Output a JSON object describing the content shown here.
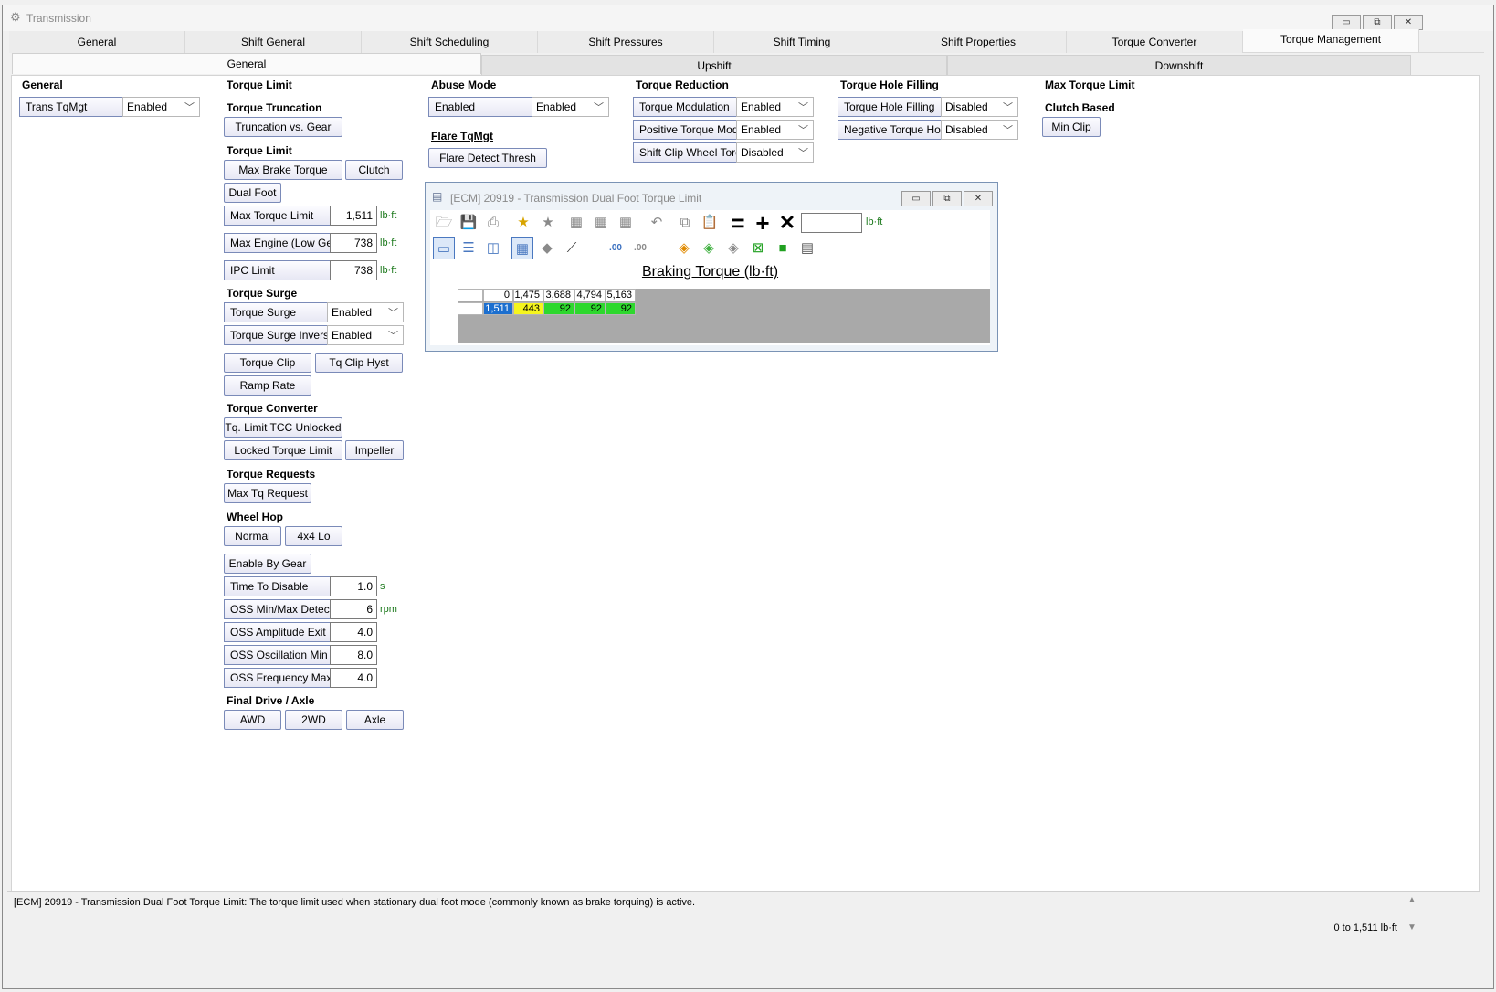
{
  "window": {
    "title": "Transmission",
    "minimize": "▭",
    "restore": "⧉",
    "close": "✕"
  },
  "top_tabs": [
    "General",
    "Shift General",
    "Shift Scheduling",
    "Shift Pressures",
    "Shift Timing",
    "Shift Properties",
    "Torque Converter",
    "Torque Management"
  ],
  "sub_tabs": [
    "General",
    "Upshift",
    "Downshift"
  ],
  "general": {
    "header": "General",
    "trans_tqmgt_label": "Trans TqMgt",
    "trans_tqmgt_value": "Enabled"
  },
  "torque_limit": {
    "header": "Torque Limit",
    "truncation_header": "Torque Truncation",
    "truncation_button": "Truncation vs. Gear",
    "limit_header": "Torque Limit",
    "max_brake_torque": "Max Brake Torque",
    "clutch": "Clutch",
    "dual_foot": "Dual Foot",
    "max_torque_limit_label": "Max Torque Limit",
    "max_torque_limit_value": "1,511",
    "max_torque_limit_unit": "lb·ft",
    "max_engine_label": "Max Engine (Low Gea",
    "max_engine_value": "738",
    "max_engine_unit": "lb·ft",
    "ipc_label": "IPC Limit",
    "ipc_value": "738",
    "ipc_unit": "lb·ft",
    "surge_header": "Torque Surge",
    "surge_label": "Torque Surge",
    "surge_value": "Enabled",
    "surge_inverse_label": "Torque Surge Inverse",
    "surge_inverse_value": "Enabled",
    "torque_clip": "Torque Clip",
    "tq_clip_hyst": "Tq Clip Hyst",
    "ramp_rate": "Ramp Rate",
    "converter_header": "Torque Converter",
    "tcc_unlocked": "Tq. Limit TCC Unlocked",
    "locked_limit": "Locked Torque Limit",
    "impeller": "Impeller",
    "requests_header": "Torque Requests",
    "max_tq_request": "Max Tq Request",
    "wheel_hop_header": "Wheel Hop",
    "normal": "Normal",
    "fourx4_lo": "4x4 Lo",
    "enable_by_gear": "Enable By Gear",
    "time_to_disable_label": "Time To Disable",
    "time_to_disable_value": "1.0",
    "time_to_disable_unit": "s",
    "oss_minmax_label": "OSS Min/Max Detecti",
    "oss_minmax_value": "6",
    "oss_minmax_unit": "rpm",
    "oss_amp_label": "OSS Amplitude Exit",
    "oss_amp_value": "4.0",
    "oss_osc_label": "OSS Oscillation Min",
    "oss_osc_value": "8.0",
    "oss_freq_label": "OSS Frequency Max",
    "oss_freq_value": "4.0",
    "final_drive_header": "Final Drive / Axle",
    "awd": "AWD",
    "twowd": "2WD",
    "axle": "Axle"
  },
  "abuse_mode": {
    "header": "Abuse Mode",
    "label": "Enabled",
    "value": "Enabled",
    "flare_header": "Flare TqMgt",
    "flare_button": "Flare Detect Thresh"
  },
  "torque_reduction": {
    "header": "Torque Reduction",
    "modulation_label": "Torque Modulation",
    "modulation_value": "Enabled",
    "positive_label": "Positive Torque Mod",
    "positive_value": "Enabled",
    "shift_clip_label": "Shift Clip Wheel Torqu",
    "shift_clip_value": "Disabled"
  },
  "torque_hole": {
    "header": "Torque Hole Filling",
    "filling_label": "Torque Hole Filling",
    "filling_value": "Disabled",
    "negative_label": "Negative Torque Hole",
    "negative_value": "Disabled"
  },
  "max_torque_limit": {
    "header": "Max Torque Limit",
    "clutch_based": "Clutch Based",
    "min_clip": "Min Clip"
  },
  "subwindow": {
    "title": "[ECM] 20919 - Transmission Dual Foot Torque Limit",
    "unit": "lb·ft",
    "table_title": "Braking Torque (lb·ft)",
    "col_headers": [
      "0",
      "1,475",
      "3,688",
      "4,794",
      "5,163"
    ],
    "row_header": "1,511",
    "row_values": [
      "443",
      "92",
      "92",
      "92"
    ],
    "colors": {
      "row_header": "#1c6fcf",
      "yellow": "#f5f51e",
      "green": "#2ed82e"
    },
    "icons_row1": [
      "folder-open-icon",
      "save-icon",
      "print-icon",
      "star-add-icon",
      "star-icon",
      "grid-icon",
      "grid-icon",
      "grid-icon",
      "undo-icon",
      "copy-icon",
      "paste-icon",
      "equals-icon",
      "plus-icon",
      "multiply-icon"
    ],
    "icons_row2": [
      "view-icon",
      "split-h-icon",
      "split-v-icon",
      "table-icon",
      "shape-icon",
      "line-chart-icon",
      "decimal-add-icon",
      "decimal-remove-icon",
      "color-icon",
      "color-icon",
      "color-icon",
      "select-icon",
      "fill-icon",
      "page-icon"
    ]
  },
  "status": {
    "description": "[ECM] 20919 - Transmission Dual Foot Torque Limit: The torque limit used when stationary dual foot mode (commonly known as brake torquing) is active.",
    "range": "0 to 1,511 lb·ft"
  }
}
